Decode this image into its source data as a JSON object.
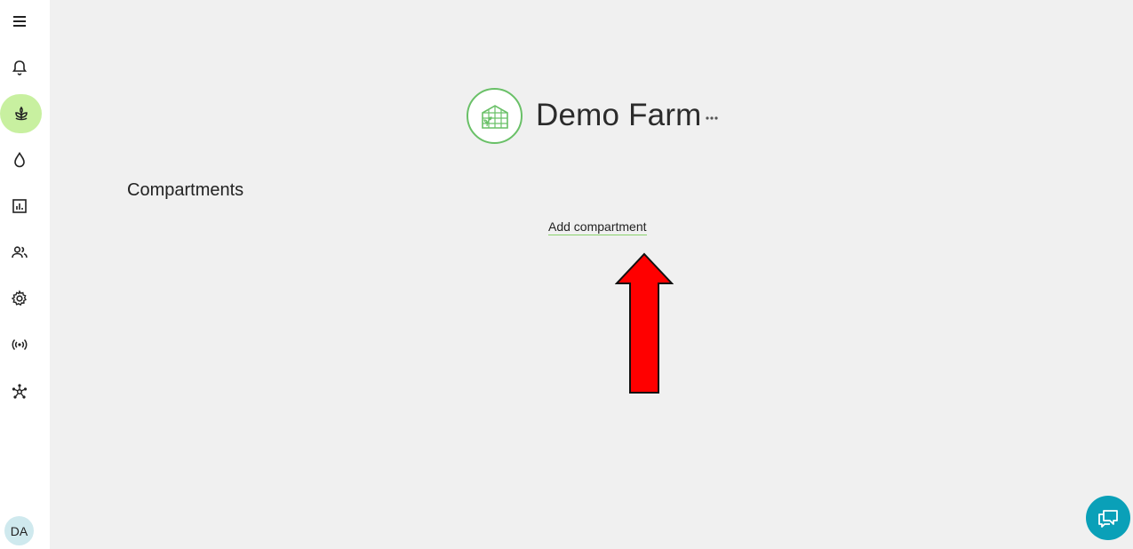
{
  "sidebar": {
    "items": [
      {
        "icon": "menu-icon"
      },
      {
        "icon": "bell-icon"
      },
      {
        "icon": "sprout-icon",
        "active": true
      },
      {
        "icon": "water-drop-icon"
      },
      {
        "icon": "chart-icon"
      },
      {
        "icon": "people-icon"
      },
      {
        "icon": "gear-icon"
      },
      {
        "icon": "broadcast-icon"
      },
      {
        "icon": "network-icon"
      }
    ],
    "avatar_initials": "DA"
  },
  "farm": {
    "name": "Demo Farm",
    "logo_icon": "greenhouse-icon",
    "more_icon": "more-horizontal-icon"
  },
  "compartments": {
    "title": "Compartments",
    "add_label": "Add compartment"
  },
  "colors": {
    "accent_green": "#69c067",
    "active_nav_bg": "#c8f0a0",
    "chat_button": "#0aa0b8",
    "annotation_arrow": "#ff0000"
  },
  "chat": {
    "icon": "chat-icon"
  }
}
